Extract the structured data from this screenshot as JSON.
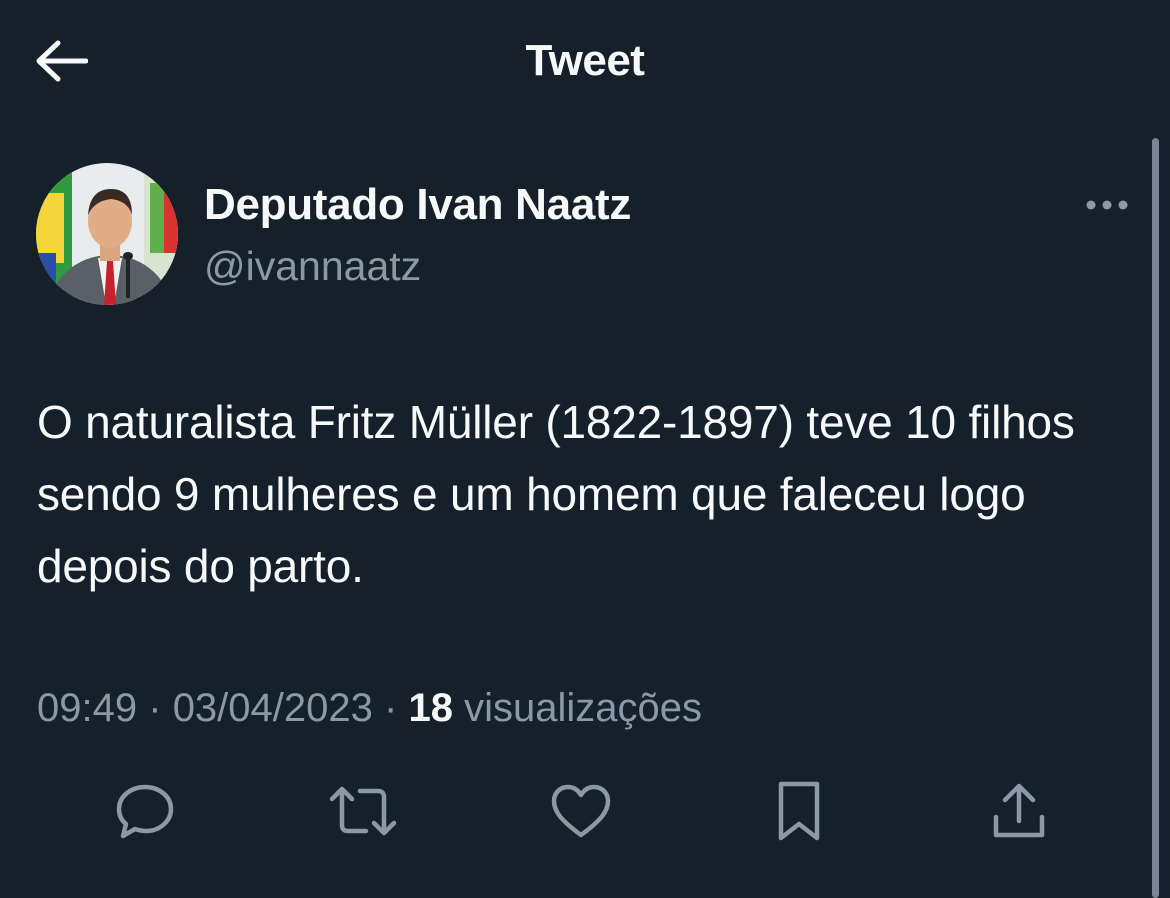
{
  "header": {
    "title": "Tweet",
    "back_icon": "arrow-left-icon"
  },
  "tweet": {
    "author": {
      "name": "Deputado Ivan Naatz",
      "handle": "@ivannaatz",
      "avatar_icon": "profile-photo-avatar"
    },
    "text": "O naturalista Fritz Müller (1822-1897) teve 10 filhos sendo 9 mulheres e um homem que faleceu logo depois do parto.",
    "time": "09:49",
    "separator": "·",
    "date": "03/04/2023",
    "views_count": "18",
    "views_label": "visualizações"
  },
  "actions": [
    {
      "name": "reply",
      "icon": "reply-icon"
    },
    {
      "name": "retweet",
      "icon": "retweet-icon"
    },
    {
      "name": "like",
      "icon": "heart-icon"
    },
    {
      "name": "bookmark",
      "icon": "bookmark-icon"
    },
    {
      "name": "share",
      "icon": "share-icon"
    }
  ],
  "colors": {
    "background": "#15202b",
    "text_primary": "#f7f9f9",
    "text_secondary": "#8b98a5"
  }
}
